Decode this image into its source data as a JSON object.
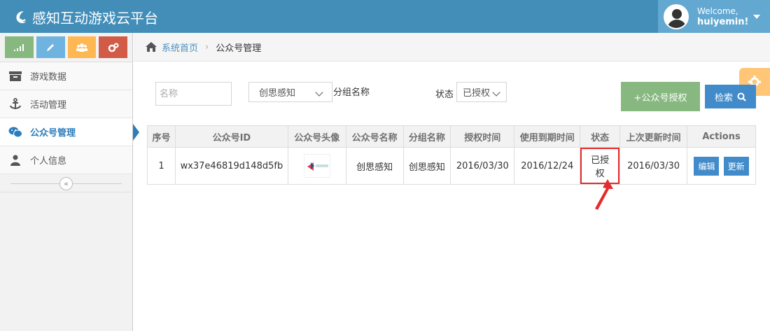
{
  "app": {
    "title": "感知互动游戏云平台"
  },
  "user": {
    "welcome": "Welcome,",
    "name": "huiyemin!"
  },
  "sidebar": {
    "items": [
      {
        "label": "游戏数据",
        "icon": "archive-icon"
      },
      {
        "label": "活动管理",
        "icon": "anchor-icon"
      },
      {
        "label": "公众号管理",
        "icon": "wechat-icon"
      },
      {
        "label": "个人信息",
        "icon": "user-icon"
      }
    ]
  },
  "breadcrumb": {
    "home": "系统首页",
    "current": "公众号管理"
  },
  "filters": {
    "name_placeholder": "名称",
    "group_value": "创思感知",
    "group_label": "分组名称",
    "status_label": "状态",
    "status_value": "已授权",
    "auth_button": "+公众号授权",
    "search_button": "检索"
  },
  "table": {
    "headers": [
      "序号",
      "公众号ID",
      "公众号头像",
      "公众号名称",
      "分组名称",
      "授权时间",
      "使用到期时间",
      "状态",
      "上次更新时间",
      "Actions"
    ],
    "rows": [
      {
        "index": "1",
        "id": "wx37e46819d148d5fb",
        "name": "创思感知",
        "group": "创思感知",
        "auth_time": "2016/03/30",
        "expire_time": "2016/12/24",
        "status": "已授权",
        "updated": "2016/03/30",
        "edit": "编辑",
        "refresh": "更新"
      }
    ]
  },
  "colors": {
    "navbar": "#438eb9",
    "primary": "#428bca",
    "success": "#87b87f",
    "highlight": "#e52b2b"
  }
}
